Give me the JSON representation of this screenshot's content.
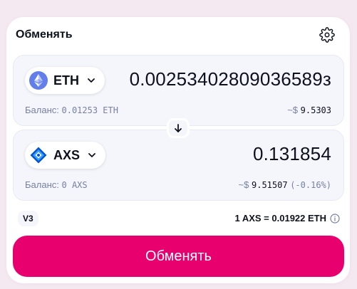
{
  "header": {
    "title": "Обменять",
    "settings_icon": "gear-icon"
  },
  "input": {
    "token": "ETH",
    "amount": "0.00253402809036589з",
    "balance_label": "Баланс:",
    "balance_value": "0.01253 ETH",
    "usd_prefix": "~$",
    "usd_value": "9.5303"
  },
  "switch_icon": "arrow-down-icon",
  "output": {
    "token": "AXS",
    "amount": "0.131854",
    "balance_label": "Баланс:",
    "balance_value": "0 AXS",
    "usd_prefix": "~$",
    "usd_value": "9.51507",
    "price_impact": "(-0.16%)"
  },
  "version_badge": "V3",
  "rate": "1 AXS = 0.01922 ETH",
  "cta_label": "Обменять",
  "colors": {
    "accent": "#e8006f",
    "eth": "#627eea",
    "axs": "#0055d5"
  }
}
